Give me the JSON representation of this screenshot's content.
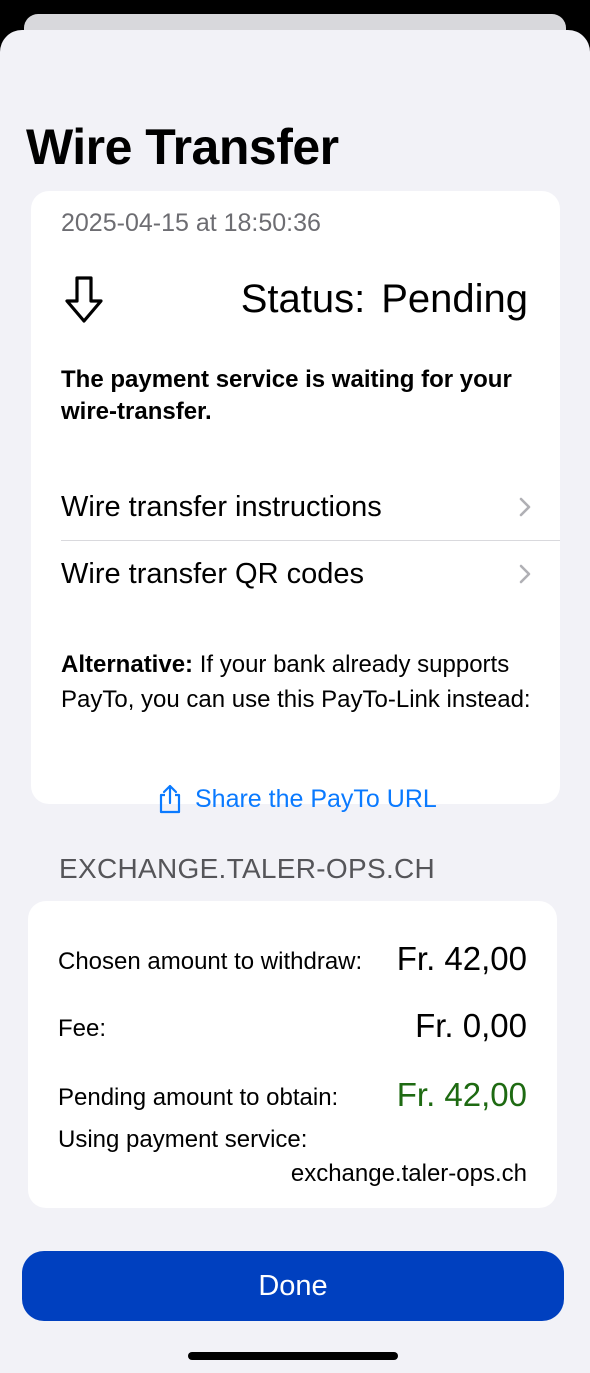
{
  "header": {
    "title": "Wire Transfer"
  },
  "transaction": {
    "timestamp": "2025-04-15 at 18:50:36",
    "status_label": "Status:",
    "status_value": "Pending",
    "waiting_message": "The payment service is waiting for your wire-transfer."
  },
  "links": [
    {
      "label": "Wire transfer instructions"
    },
    {
      "label": "Wire transfer QR codes"
    }
  ],
  "alternative": {
    "bold": "Alternative:",
    "text": " If your bank already supports PayTo, you can use this PayTo-Link instead:",
    "share_label": "Share the PayTo URL"
  },
  "exchange": {
    "section_header": "EXCHANGE.TALER-OPS.CH",
    "chosen_label": "Chosen amount to withdraw:",
    "chosen_value": "Fr. 42,00",
    "fee_label": "Fee:",
    "fee_value": "Fr. 0,00",
    "pending_label": "Pending amount to obtain:",
    "pending_value": "Fr. 42,00",
    "service_label": "Using payment service:",
    "service_value": "exchange.taler-ops.ch"
  },
  "footer": {
    "done_label": "Done"
  },
  "colors": {
    "accent": "#0a7aff",
    "button": "#0040bf",
    "pending_amount": "#1e6a12",
    "background": "#f2f2f7"
  },
  "icons": {
    "status": "arrow-down-icon",
    "nav": "chevron-right-icon",
    "share": "share-icon"
  }
}
